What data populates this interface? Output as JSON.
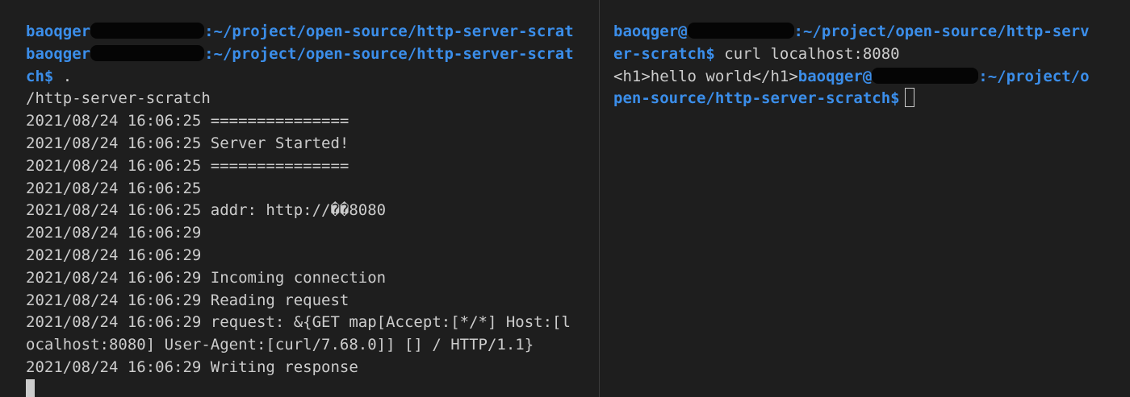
{
  "left_terminal": {
    "line1": {
      "user": "baoqger",
      "path": ":~/project/open-source/http-server-scrat"
    },
    "line2": {
      "user": "baoqger",
      "path": ":~/project/open-source/http-server-scrat"
    },
    "line3": {
      "prompt": "ch$",
      "command": " ."
    },
    "output": [
      "/http-server-scratch",
      "2021/08/24 16:06:25 ===============",
      "2021/08/24 16:06:25 Server Started!",
      "2021/08/24 16:06:25 ===============",
      "2021/08/24 16:06:25",
      "2021/08/24 16:06:25 addr: http://��8080",
      "2021/08/24 16:06:29",
      "2021/08/24 16:06:29",
      "2021/08/24 16:06:29 Incoming connection",
      "2021/08/24 16:06:29 Reading request",
      "2021/08/24 16:06:29 request: &{GET map[Accept:[*/*] Host:[l",
      "ocalhost:8080] User-Agent:[curl/7.68.0]] [] / HTTP/1.1}",
      "2021/08/24 16:06:29 Writing response"
    ]
  },
  "right_terminal": {
    "line1": {
      "user": "baoqger@",
      "path": ":~/project/open-source/http-serv"
    },
    "line2": {
      "prompt": "er-scratch$",
      "command": " curl localhost:8080"
    },
    "line3": {
      "output": "<h1>hello world</h1>",
      "user": "baoqger@",
      "path": ":~/project/o"
    },
    "line4": {
      "prompt": "pen-source/http-server-scratch$"
    }
  },
  "colors": {
    "background": "#1e1e1e",
    "text": "#cccccc",
    "prompt": "#3b8eea",
    "divider": "#3c3c3c"
  }
}
